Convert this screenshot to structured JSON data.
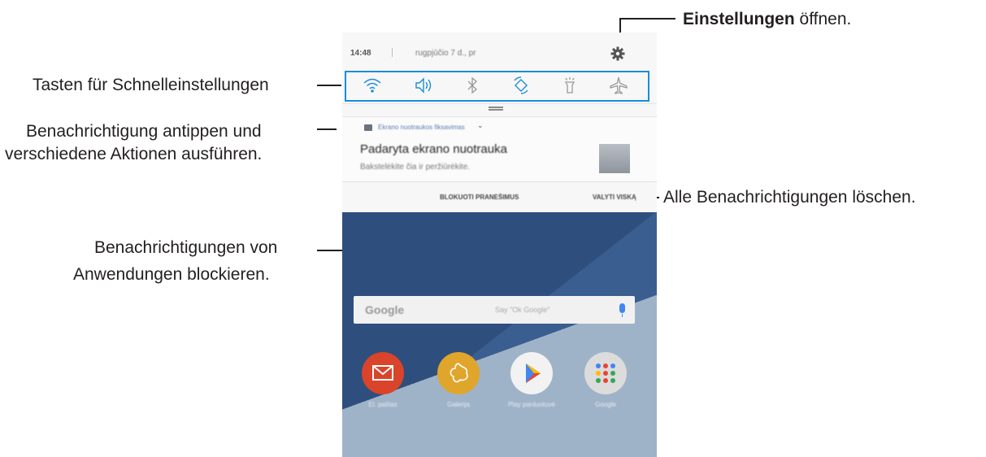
{
  "callouts": {
    "settings_bold": "Einstellungen",
    "settings_rest": " öffnen.",
    "quick_settings": "Tasten für Schnelleinstellungen",
    "notification_line1": "Benachrichtigung antippen und",
    "notification_line2": "verschiedene Aktionen ausführen.",
    "clear_all": "Alle Benachrichtigungen löschen.",
    "block_line1": "Benachrichtigungen von",
    "block_line2": "Anwendungen blockieren."
  },
  "phone": {
    "status": {
      "time": "14:48",
      "date": "rugpjūčio 7 d., pr"
    },
    "quick_settings": [
      {
        "icon": "wifi-icon"
      },
      {
        "icon": "sound-icon"
      },
      {
        "icon": "bluetooth-icon"
      },
      {
        "icon": "auto-rotate-icon"
      },
      {
        "icon": "flashlight-icon"
      },
      {
        "icon": "airplane-mode-icon"
      }
    ],
    "notification": {
      "app": "Ekrano nuotraukos fiksavimas",
      "title": "Padaryta ekrano nuotrauka",
      "text": "Bakstelėkite čia ir peržiūrėkite."
    },
    "actions": {
      "block": "BLOKUOTI PRANEŠIMUS",
      "clear": "VALYTI VISKĄ"
    },
    "home": {
      "search_logo": "Google",
      "search_hint": "Say \"Ok Google\"",
      "apps": [
        {
          "label": "El. paštas",
          "color": "#d9442a"
        },
        {
          "label": "Galerija",
          "color": "#e0a52b"
        },
        {
          "label": "Play parduotuvė",
          "color": "#f2f2f2"
        },
        {
          "label": "Google",
          "color": "#dcdcdc"
        }
      ]
    },
    "colors": {
      "accent": "#1a8ed8"
    }
  }
}
